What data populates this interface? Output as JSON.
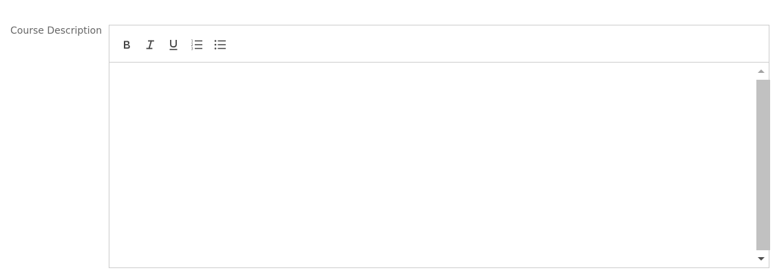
{
  "field": {
    "label": "Course Description"
  },
  "toolbar": {
    "buttons": [
      {
        "name": "bold",
        "icon": "bold-icon"
      },
      {
        "name": "italic",
        "icon": "italic-icon"
      },
      {
        "name": "underline",
        "icon": "underline-icon"
      },
      {
        "name": "ordered-list",
        "icon": "ordered-list-icon"
      },
      {
        "name": "unordered-list",
        "icon": "unordered-list-icon"
      }
    ]
  },
  "editor": {
    "value": ""
  },
  "scrollbar": {
    "up_icon": "scroll-up-arrow-icon",
    "down_icon": "scroll-down-arrow-icon",
    "thumb_color": "#c1c1c1"
  },
  "colors": {
    "border": "#cccccc",
    "label": "#666666",
    "icon": "#444444"
  }
}
